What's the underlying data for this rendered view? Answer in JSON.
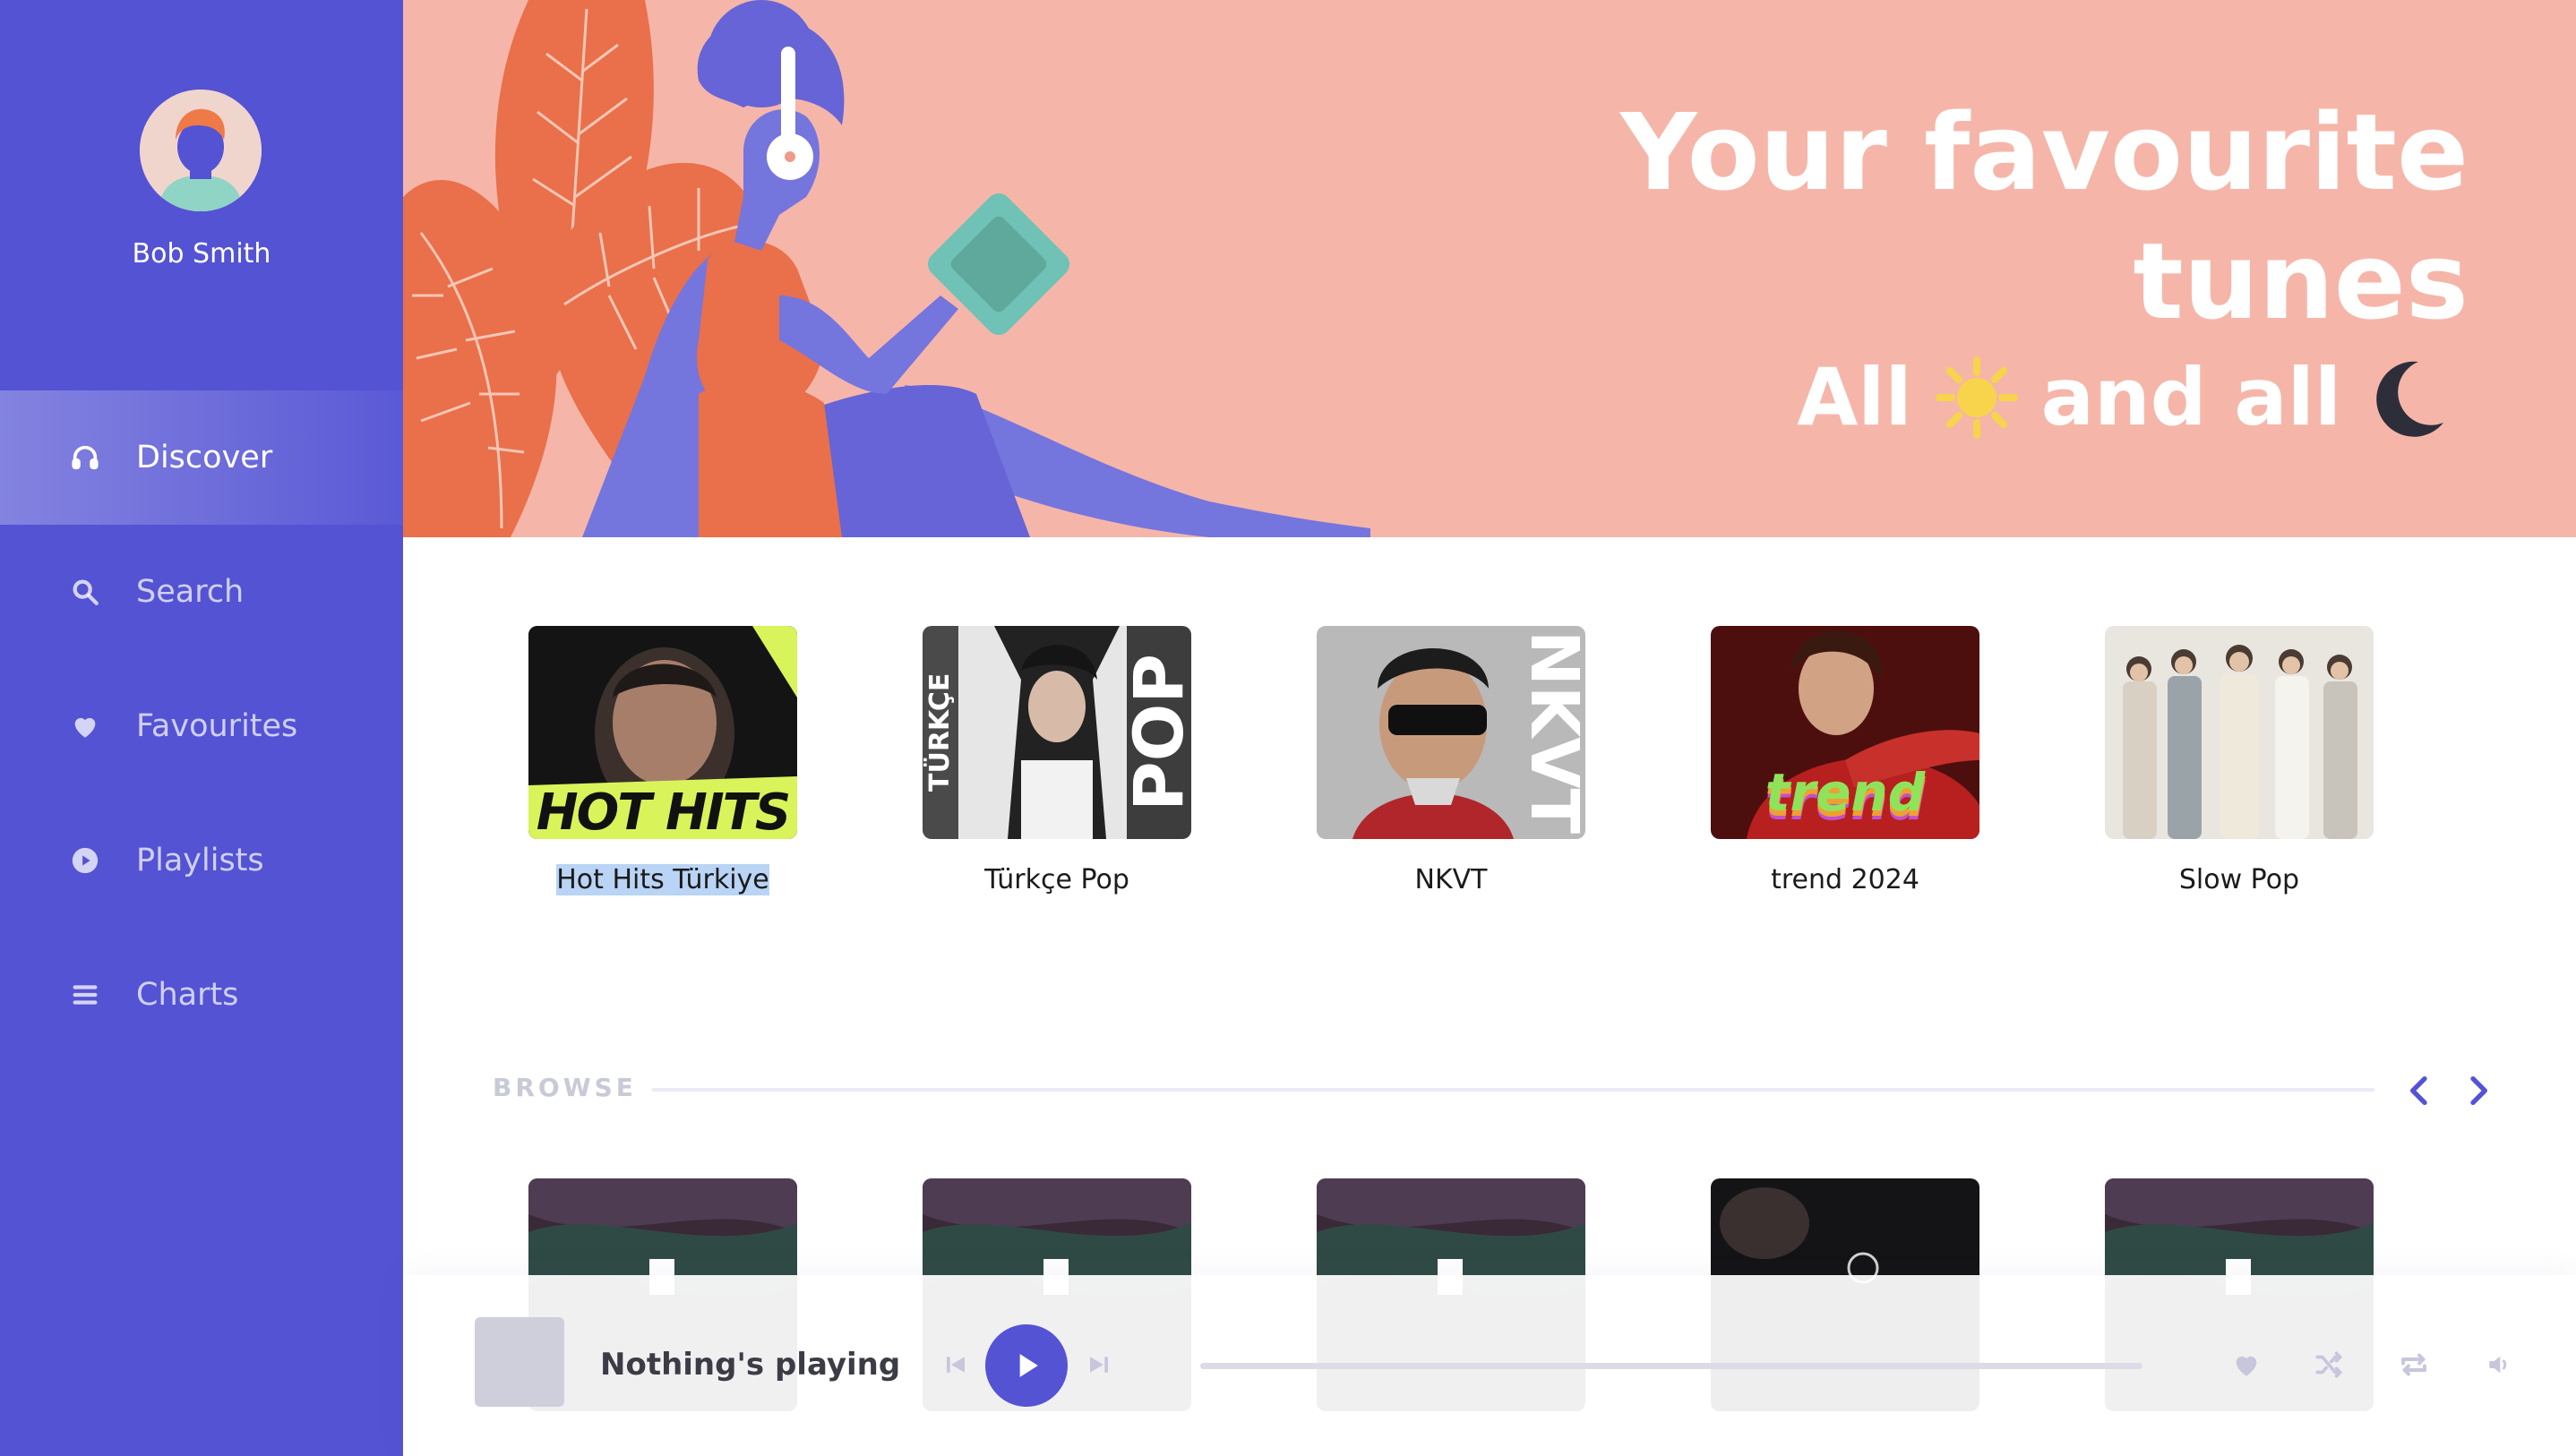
{
  "user": {
    "name": "Bob Smith"
  },
  "nav": [
    {
      "label": "Discover",
      "icon": "headphones-icon",
      "active": true
    },
    {
      "label": "Search",
      "icon": "search-icon"
    },
    {
      "label": "Favourites",
      "icon": "heart-icon"
    },
    {
      "label": "Playlists",
      "icon": "play-circle-icon"
    },
    {
      "label": "Charts",
      "icon": "list-icon"
    }
  ],
  "hero": {
    "title_line1": "Your favourite",
    "title_line2": "tunes",
    "sub_all": "All",
    "sub_and_all": "and all",
    "sun_icon": "sun-icon",
    "moon_icon": "moon-icon"
  },
  "featured": [
    {
      "title": "Hot Hits Türkiye",
      "cover_text": "HOT HITS"
    },
    {
      "title": "Türkçe Pop",
      "cover_text_left": "TÜRKÇE",
      "cover_text_right": "POP"
    },
    {
      "title": "NKVT",
      "cover_text": "NKVT"
    },
    {
      "title": "trend 2024",
      "cover_text": "trend"
    },
    {
      "title": "Slow Pop"
    }
  ],
  "browse": {
    "title": "BROWSE"
  },
  "player": {
    "status": "Nothing's playing"
  },
  "colors": {
    "accent": "#5453d4",
    "hero_bg": "#f5b6a9",
    "leaf": "#e9704a",
    "figure": "#7575de",
    "sun": "#f7d44c",
    "moon": "#2e2e3a"
  }
}
